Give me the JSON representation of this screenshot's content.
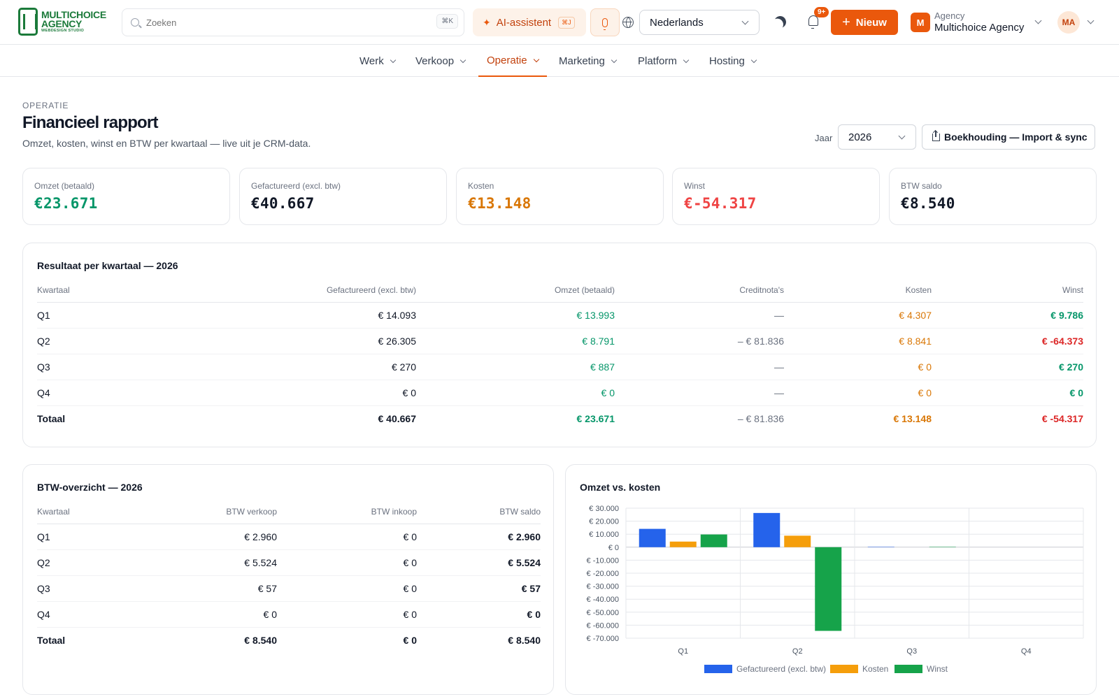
{
  "brand": {
    "line1": "MULTICHOICE",
    "line2": "AGENCY",
    "line3": "WEBDESIGN STUDIO"
  },
  "search": {
    "placeholder": "Zoeken",
    "shortcut": "⌘K"
  },
  "ai": {
    "label": "AI-assistent",
    "shortcut": "⌘J"
  },
  "language": {
    "selected": "Nederlands"
  },
  "notifications": {
    "badge": "9+"
  },
  "new_button": {
    "label": "Nieuw"
  },
  "agency": {
    "logo_letter": "M",
    "small": "Agency",
    "name": "Multichoice Agency"
  },
  "user": {
    "initials": "MA"
  },
  "nav": [
    {
      "label": "Werk"
    },
    {
      "label": "Verkoop"
    },
    {
      "label": "Operatie"
    },
    {
      "label": "Marketing"
    },
    {
      "label": "Platform"
    },
    {
      "label": "Hosting"
    }
  ],
  "header": {
    "eyebrow": "OPERATIE",
    "title": "Financieel rapport",
    "subtitle": "Omzet, kosten, winst en BTW per kwartaal — live uit je CRM-data.",
    "year_label": "Jaar",
    "year": "2026",
    "sync_label": "Boekhouding — Import & sync"
  },
  "kpis": [
    {
      "label": "Omzet (betaald)",
      "value": "€23.671",
      "color": "#059669"
    },
    {
      "label": "Gefactureerd (excl. btw)",
      "value": "€40.667",
      "color": "#111827"
    },
    {
      "label": "Kosten",
      "value": "€13.148",
      "color": "#d97706"
    },
    {
      "label": "Winst",
      "value": "€-54.317",
      "color": "#ef4444"
    },
    {
      "label": "BTW saldo",
      "value": "€8.540",
      "color": "#111827"
    }
  ],
  "quarter_table": {
    "title": "Resultaat per kwartaal — 2026",
    "headers": [
      "Kwartaal",
      "Gefactureerd (excl. btw)",
      "Omzet (betaald)",
      "Creditnota's",
      "Kosten",
      "Winst"
    ],
    "rows": [
      [
        "Q1",
        "€ 14.093",
        "€ 13.993",
        "—",
        "€ 4.307",
        "€ 9.786"
      ],
      [
        "Q2",
        "€ 26.305",
        "€ 8.791",
        "– € 81.836",
        "€ 8.841",
        "€ -64.373"
      ],
      [
        "Q3",
        "€ 270",
        "€ 887",
        "—",
        "€ 0",
        "€ 270"
      ],
      [
        "Q4",
        "€ 0",
        "€ 0",
        "—",
        "€ 0",
        "€ 0"
      ]
    ],
    "total": [
      "Totaal",
      "€ 40.667",
      "€ 23.671",
      "– € 81.836",
      "€ 13.148",
      "€ -54.317"
    ]
  },
  "vat_table": {
    "title": "BTW-overzicht — 2026",
    "headers": [
      "Kwartaal",
      "BTW verkoop",
      "BTW inkoop",
      "BTW saldo"
    ],
    "rows": [
      [
        "Q1",
        "€ 2.960",
        "€ 0",
        "€ 2.960"
      ],
      [
        "Q2",
        "€ 5.524",
        "€ 0",
        "€ 5.524"
      ],
      [
        "Q3",
        "€ 57",
        "€ 0",
        "€ 57"
      ],
      [
        "Q4",
        "€ 0",
        "€ 0",
        "€ 0"
      ]
    ],
    "total": [
      "Totaal",
      "€ 8.540",
      "€ 0",
      "€ 8.540"
    ]
  },
  "chart_title": "Omzet vs. kosten",
  "chart_data": {
    "type": "bar",
    "title": "Omzet vs. kosten",
    "categories": [
      "Q1",
      "Q2",
      "Q3",
      "Q4"
    ],
    "series": [
      {
        "name": "Gefactureerd (excl. btw)",
        "values": [
          14093,
          26305,
          270,
          0
        ],
        "color": "#2563eb"
      },
      {
        "name": "Kosten",
        "values": [
          4307,
          8841,
          0,
          0
        ],
        "color": "#f59e0b"
      },
      {
        "name": "Winst",
        "values": [
          9786,
          -64373,
          270,
          0
        ],
        "color": "#16a34a"
      }
    ],
    "yticks": [
      "€ 30.000",
      "€ 20.000",
      "€ 10.000",
      "€ 0",
      "€ -10.000",
      "€ -20.000",
      "€ -30.000",
      "€ -40.000",
      "€ -50.000",
      "€ -60.000",
      "€ -70.000"
    ],
    "ylim": [
      -70000,
      30000
    ],
    "grid": true,
    "legend_position": "bottom"
  }
}
